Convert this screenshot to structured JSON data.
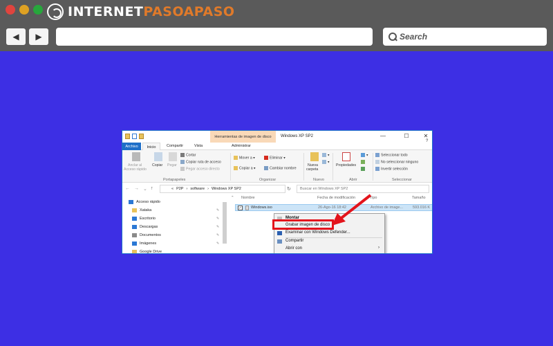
{
  "browser": {
    "brand_plain": "INTERNET",
    "brand_accent": "PASOAPASO",
    "back_label": "◀",
    "forward_label": "▶",
    "search_placeholder": "Search",
    "lights": [
      "#e0443e",
      "#dea123",
      "#27a73c"
    ]
  },
  "explorer": {
    "contextual_tab": "Herramientas de imagen de disco",
    "window_title": "Windows XP SP2",
    "tabs": [
      "Archivo",
      "Inicio",
      "Compartir",
      "Vista",
      "Administrar"
    ],
    "ribbon": {
      "pin_label": "Anclar al",
      "pin_label2": "Acceso rápido",
      "copy_label": "Copiar",
      "paste_label": "Pegar",
      "cut_label": "Cortar",
      "copy_path_label": "Copiar ruta de acceso",
      "paste_shortcut_label": "Pegar acceso directo",
      "move_label": "Mover a",
      "copy_to_label": "Copiar a",
      "delete_label": "Eliminar",
      "rename_label": "Cambiar nombre",
      "new_folder_label": "Nueva",
      "new_folder_label2": "carpeta",
      "properties_label": "Propiedades",
      "select_all_label": "Seleccionar todo",
      "select_none_label": "No seleccionar ninguno",
      "invert_label": "Invertir selección",
      "groups": [
        "Portapapeles",
        "Organizar",
        "Nuevo",
        "Abrir",
        "Seleccionar"
      ]
    },
    "address": {
      "crumbs": [
        "«",
        "P2P",
        "›",
        "software",
        "›",
        "Windows XP SP2"
      ],
      "search_placeholder": "Buscar en Windows XP SP2"
    },
    "nav": [
      {
        "label": "Acceso rápido",
        "color": "#2b78d4"
      },
      {
        "label": "Xataka",
        "color": "#e8c25a"
      },
      {
        "label": "Escritorio",
        "color": "#2b78d4"
      },
      {
        "label": "Descargas",
        "color": "#2b78d4"
      },
      {
        "label": "Documentos",
        "color": "#8a8a8a"
      },
      {
        "label": "Imágenes",
        "color": "#2b78d4"
      },
      {
        "label": "Google Drive",
        "color": "#e8c25a"
      }
    ],
    "columns": [
      "Nombre",
      "Fecha de modificación",
      "Tipo",
      "Tamaño"
    ],
    "file": {
      "name": "Windows.iso",
      "date": "26-Ago-16 18:42",
      "type": "Archivo de image...",
      "size": "593.016 K"
    },
    "context_menu": [
      "Montar",
      "Grabar imagen de disco",
      "Examinar con Windows Defender...",
      "Compartir",
      "Abrir con"
    ]
  }
}
